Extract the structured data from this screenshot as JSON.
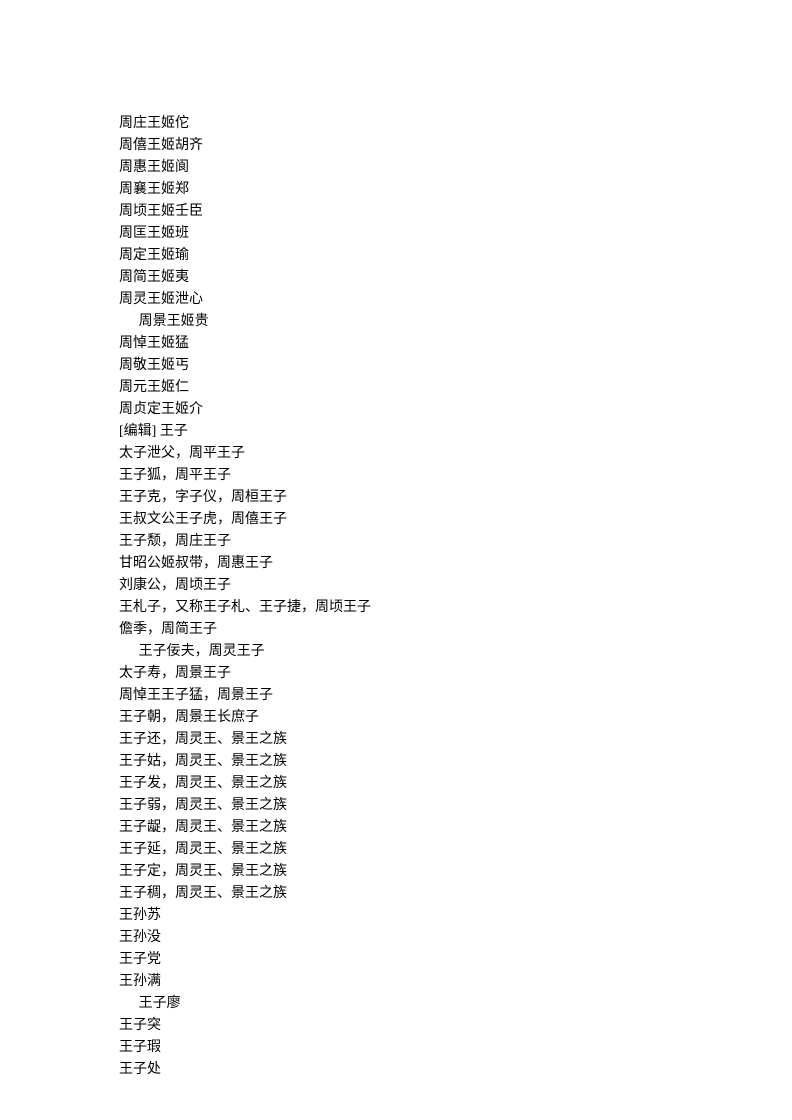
{
  "lines": [
    {
      "text": "周庄王姬佗",
      "indent": false
    },
    {
      "text": "周僖王姬胡齐",
      "indent": false
    },
    {
      "text": "周惠王姬阆",
      "indent": false
    },
    {
      "text": "周襄王姬郑",
      "indent": false
    },
    {
      "text": "周顷王姬壬臣",
      "indent": false
    },
    {
      "text": "周匡王姬班",
      "indent": false
    },
    {
      "text": "周定王姬瑜",
      "indent": false
    },
    {
      "text": "周简王姬夷",
      "indent": false
    },
    {
      "text": "周灵王姬泄心",
      "indent": false
    },
    {
      "text": "周景王姬贵",
      "indent": true
    },
    {
      "text": "周悼王姬猛",
      "indent": false
    },
    {
      "text": "周敬王姬丐",
      "indent": false
    },
    {
      "text": "周元王姬仁",
      "indent": false
    },
    {
      "text": "周贞定王姬介",
      "indent": false
    },
    {
      "text": "[编辑] 王子",
      "indent": false
    },
    {
      "text": "太子泄父，周平王子",
      "indent": false
    },
    {
      "text": "王子狐，周平王子",
      "indent": false
    },
    {
      "text": "王子克，字子仪，周桓王子",
      "indent": false
    },
    {
      "text": "王叔文公王子虎，周僖王子",
      "indent": false
    },
    {
      "text": "王子颓，周庄王子",
      "indent": false
    },
    {
      "text": "甘昭公姬叔带，周惠王子",
      "indent": false
    },
    {
      "text": "刘康公，周顷王子",
      "indent": false
    },
    {
      "text": "王札子，又称王子札、王子捷，周顷王子",
      "indent": false
    },
    {
      "text": "儋季，周简王子",
      "indent": false
    },
    {
      "text": "王子佞夫，周灵王子",
      "indent": true
    },
    {
      "text": "太子寿，周景王子",
      "indent": false
    },
    {
      "text": "周悼王王子猛，周景王子",
      "indent": false
    },
    {
      "text": "王子朝，周景王长庶子",
      "indent": false
    },
    {
      "text": "王子还，周灵王、景王之族",
      "indent": false
    },
    {
      "text": "王子姑，周灵王、景王之族",
      "indent": false
    },
    {
      "text": "王子发，周灵王、景王之族",
      "indent": false
    },
    {
      "text": "王子弱，周灵王、景王之族",
      "indent": false
    },
    {
      "text": "王子龊，周灵王、景王之族",
      "indent": false
    },
    {
      "text": "王子延，周灵王、景王之族",
      "indent": false
    },
    {
      "text": "王子定，周灵王、景王之族",
      "indent": false
    },
    {
      "text": "王子稠，周灵王、景王之族",
      "indent": false
    },
    {
      "text": "王孙苏",
      "indent": false
    },
    {
      "text": "王孙没",
      "indent": false
    },
    {
      "text": "王子党",
      "indent": false
    },
    {
      "text": "王孙满",
      "indent": false
    },
    {
      "text": "王子廖",
      "indent": true
    },
    {
      "text": "王子突",
      "indent": false
    },
    {
      "text": "王子瑕",
      "indent": false
    },
    {
      "text": "王子处",
      "indent": false
    }
  ]
}
